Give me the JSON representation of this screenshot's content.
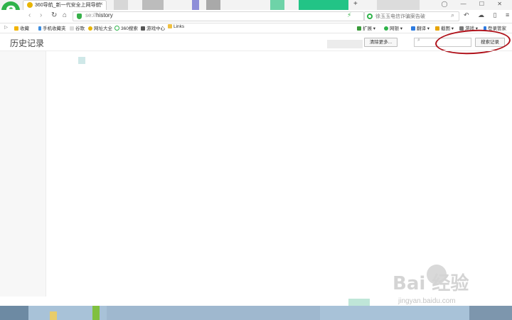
{
  "browser": {
    "tab": {
      "title": "360导航_新一代安全上网导航",
      "close": "×"
    },
    "new_tab": "+",
    "window_controls": "◯ — ☐ ✕",
    "nav": {
      "back": "‹",
      "forward": "›",
      "refresh": "↻",
      "home": "⌂"
    },
    "address": {
      "scheme": "se://",
      "path": "history"
    },
    "search": {
      "placeholder": "徐玉玉电信诈骗案告破"
    },
    "tool_glyphs": "↶ ☁ ▯ ≡"
  },
  "bookmarks": {
    "left": [
      {
        "label": "收藏",
        "color": "#f2b400"
      },
      {
        "label": "手机收藏夹",
        "color": "#3c8de0"
      },
      {
        "label": "谷歌",
        "color": "#999999"
      },
      {
        "label": "网址大全",
        "color": "#e8b400"
      },
      {
        "label": "360搜索",
        "color": "#2fb34a"
      },
      {
        "label": "游戏中心",
        "color": "#555555"
      },
      {
        "label": "Links",
        "color": "#f0c040"
      }
    ],
    "right": [
      {
        "label": "扩展",
        "color": "#3a9b3a"
      },
      {
        "label": "网银",
        "color": "#2fb34a"
      },
      {
        "label": "翻译",
        "color": "#2d7be0"
      },
      {
        "label": "截图",
        "color": "#e7a400"
      },
      {
        "label": "游戏",
        "color": "#777777"
      },
      {
        "label": "登录管家",
        "color": "#2d7be0"
      }
    ]
  },
  "page": {
    "title": "历史记录",
    "clear_button": "清除更多...",
    "search_button": "搜索记录"
  },
  "watermark": {
    "main": "Bai 经验",
    "sub": "jingyan.baidu.com"
  },
  "colors": {
    "accent_green": "#2fb34a",
    "annotation_red": "#b0121b"
  }
}
